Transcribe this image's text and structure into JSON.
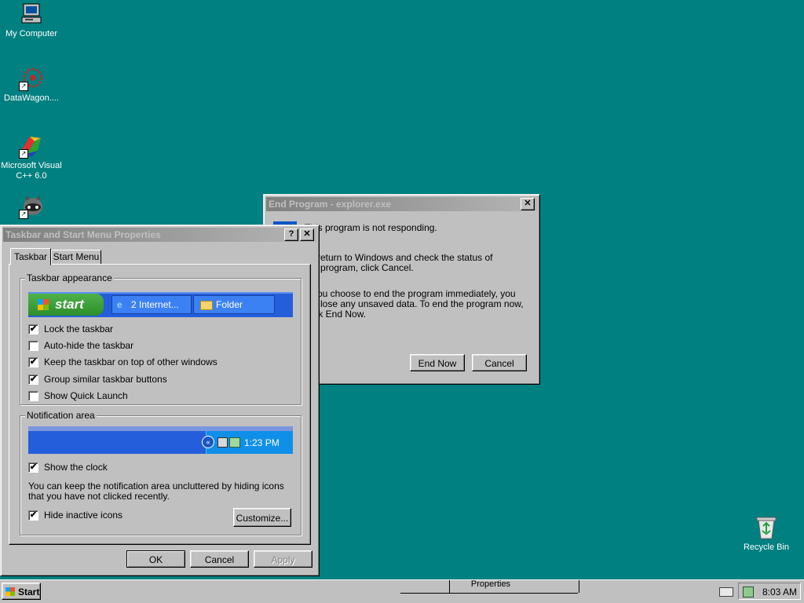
{
  "desktop": {
    "icons": [
      {
        "label": "My Computer"
      },
      {
        "label": "DataWagon...."
      },
      {
        "label": "Microsoft Visual C++ 6.0"
      },
      {
        "label": ""
      },
      {
        "label": "Recycle Bin"
      }
    ]
  },
  "end_program": {
    "title": "End Program - explorer.exe",
    "line1": "This program is not responding.",
    "line2": "To return to Windows and check the status of the program, click Cancel.",
    "line3": "If you choose to end the program immediately, you will lose any unsaved data. To end the program now, click End Now.",
    "end_now": "End Now",
    "cancel": "Cancel"
  },
  "taskbar_props": {
    "title": "Taskbar and Start Menu Properties",
    "help": "?",
    "close": "✕",
    "tabs": [
      "Taskbar",
      "Start Menu"
    ],
    "appearance_label": "Taskbar appearance",
    "preview": {
      "start": "start",
      "btn1": "2 Internet...",
      "btn2": "Folder"
    },
    "options": [
      {
        "label": "Lock the taskbar",
        "checked": "✔"
      },
      {
        "label": "Auto-hide the taskbar",
        "checked": ""
      },
      {
        "label": "Keep the taskbar on top of other windows",
        "checked": "✔"
      },
      {
        "label": "Group similar taskbar buttons",
        "checked": "✔"
      },
      {
        "label": "Show Quick Launch",
        "checked": ""
      }
    ],
    "notification_label": "Notification area",
    "preview_time": "1:23 PM",
    "show_clock": {
      "label": "Show the clock",
      "checked": "✔"
    },
    "note": "You can keep the notification area uncluttered by hiding icons that you have not clicked recently.",
    "hide_inactive": {
      "label": "Hide inactive icons",
      "checked": "✔"
    },
    "customize": "Customize...",
    "ok": "OK",
    "cancel": "Cancel",
    "apply": "Apply"
  },
  "taskbar": {
    "start": "Start",
    "task": "Properties",
    "clock": "8:03 AM"
  }
}
